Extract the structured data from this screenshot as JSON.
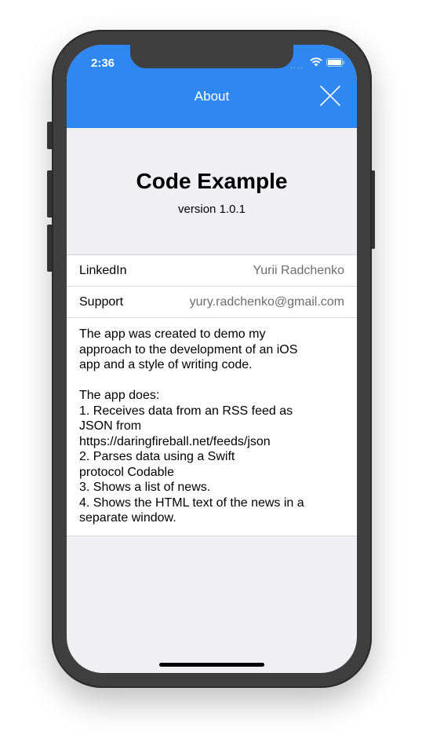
{
  "status_bar": {
    "time": "2:36",
    "signal_dots": "....",
    "wifi_icon": "wifi-icon",
    "battery_icon": "battery-icon"
  },
  "nav": {
    "title": "About",
    "close_icon": "close-icon"
  },
  "app": {
    "name": "Code Example",
    "version": "version 1.0.1"
  },
  "info_rows": [
    {
      "label": "LinkedIn",
      "value": "Yurii Radchenko"
    },
    {
      "label": "Support",
      "value": "yury.radchenko@gmail.com"
    }
  ],
  "description": "The app was created to demo my approach to the development of an iOS app and a style of writing code.\n\nThe app does:\n1. Receives data from an RSS feed as JSON from\nhttps://daringfireball.net/feeds/json\n2. Parses data using a Swift\nprotocol Codable\n3. Shows a list of news.\n4. Shows the HTML text of the news in a separate window.",
  "colors": {
    "accent": "#2f87f2",
    "background": "#efeff4",
    "secondary_text": "#6d6d72"
  }
}
